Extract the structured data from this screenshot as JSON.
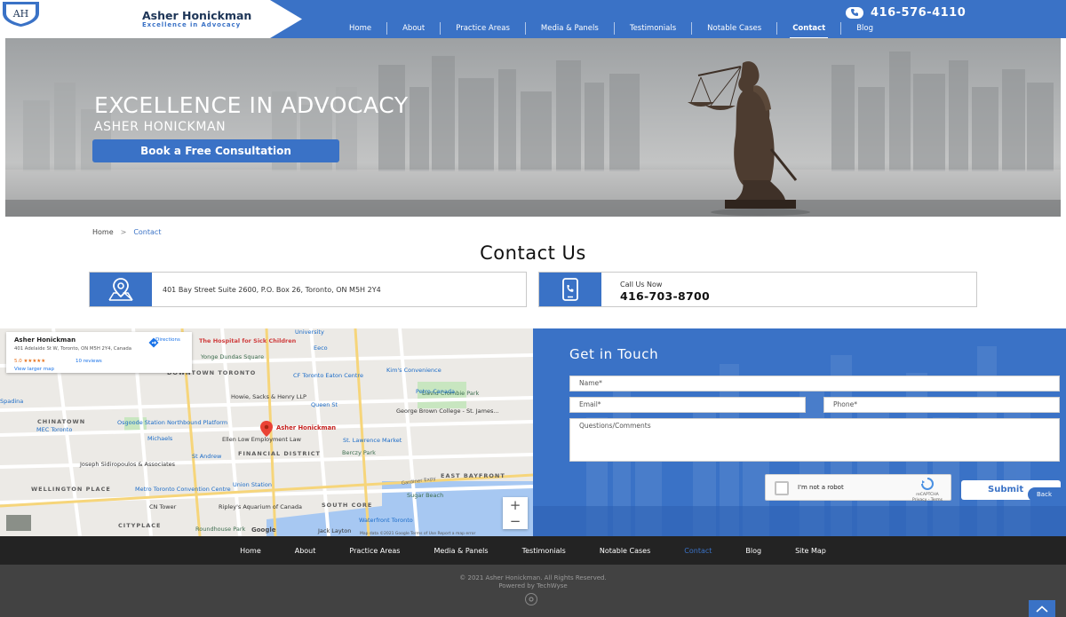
{
  "header": {
    "logo_initials": "AH",
    "logo_name": "Asher Honickman",
    "logo_tagline": "Excellence in Advocacy",
    "phone": "416-576-4110",
    "nav": [
      "Home",
      "About",
      "Practice Areas",
      "Media & Panels",
      "Testimonials",
      "Notable Cases",
      "Contact",
      "Blog"
    ],
    "active_nav": "Contact"
  },
  "hero": {
    "title": "EXCELLENCE IN ADVOCACY",
    "subtitle": "ASHER HONICKMAN",
    "cta_label": "Book a Free Consultation"
  },
  "breadcrumb": {
    "home": "Home",
    "separator": ">",
    "current": "Contact"
  },
  "page_title": "Contact Us",
  "contact": {
    "address": "401 Bay Street Suite 2600, P.O. Box 26, Toronto, ON M5H 2Y4",
    "address_icon": "map-pin-icon",
    "call_label": "Call Us Now",
    "call_number": "416-703-8700",
    "call_icon": "phone-icon"
  },
  "map": {
    "card_name": "Asher Honickman",
    "card_address": "401 Adelaide St W, Toronto, ON M5H 2Y4, Canada",
    "card_rating": "5.0 ★★★★★",
    "card_reviews": "10 reviews",
    "card_view_larger": "View larger map",
    "card_directions": "Directions",
    "pin_label": "Asher Honickman",
    "zoom_in": "+",
    "zoom_out": "−",
    "labels": {
      "hospital": "The Hospital for Sick Children",
      "yonge_dundas": "Yonge Dundas Square",
      "downtown": "DOWNTOWN TORONTO",
      "eaton": "CF Toronto Eaton Centre",
      "kims": "Kim's Convenience",
      "petro": "Petro-Canada",
      "howie": "Howie, Sacks & Henry LLP",
      "queen": "Queen St",
      "george_brown": "George Brown College - St. James...",
      "chinatown": "CHINATOWN",
      "osgoode": "Osgoode Station Northbound Platform",
      "michaels": "Michaels",
      "ellen_low": "Ellen Low Employment Law",
      "st_lawrence": "St. Lawrence Market",
      "david_crombie": "David Crombie Park",
      "mec": "MEC Toronto",
      "st_andrew": "St Andrew",
      "financial": "FINANCIAL DISTRICT",
      "berczy": "Berczy Park",
      "joseph": "Joseph Sidiropoulos & Associates",
      "union": "Union Station",
      "metro": "Metro Toronto Convention Centre",
      "gardiner": "Gardiner Expy",
      "sugar_beach": "Sugar Beach",
      "east_bayfront": "EAST BAYFRONT",
      "wellington": "WELLINGTON PLACE",
      "cn_tower": "CN Tower",
      "ripley": "Ripley's Aquarium of Canada",
      "south_core": "SOUTH CORE",
      "waterfront": "Waterfront Toronto",
      "cityplace": "CITYPLACE",
      "roundhouse": "Roundhouse Park",
      "jack_layton": "Jack Layton",
      "spadina": "Spadina",
      "union_st": "University",
      "eeco": "Eeco",
      "google": "Google",
      "attribution": "Map data ©2021 Google   Terms of Use   Report a map error"
    }
  },
  "form": {
    "title": "Get in Touch",
    "name_placeholder": "Name*",
    "email_placeholder": "Email*",
    "phone_placeholder": "Phone*",
    "comments_placeholder": "Questions/Comments",
    "captcha_label": "I'm not a robot",
    "captcha_brand": "reCAPTCHA",
    "captcha_terms": "Privacy - Terms",
    "submit_label": "Submit",
    "back_label": "Back"
  },
  "footer": {
    "nav": [
      "Home",
      "About",
      "Practice Areas",
      "Media & Panels",
      "Testimonials",
      "Notable Cases",
      "Contact",
      "Blog",
      "Site Map"
    ],
    "active_nav": "Contact",
    "copyright": "© 2021 Asher Honickman. All Rights Reserved.",
    "powered": "Powered by TechWyse"
  },
  "colors": {
    "brand_blue": "#3a72c6",
    "dark_navy": "#1d3557",
    "footer_dark": "#232323",
    "footer_grey": "#424242"
  }
}
